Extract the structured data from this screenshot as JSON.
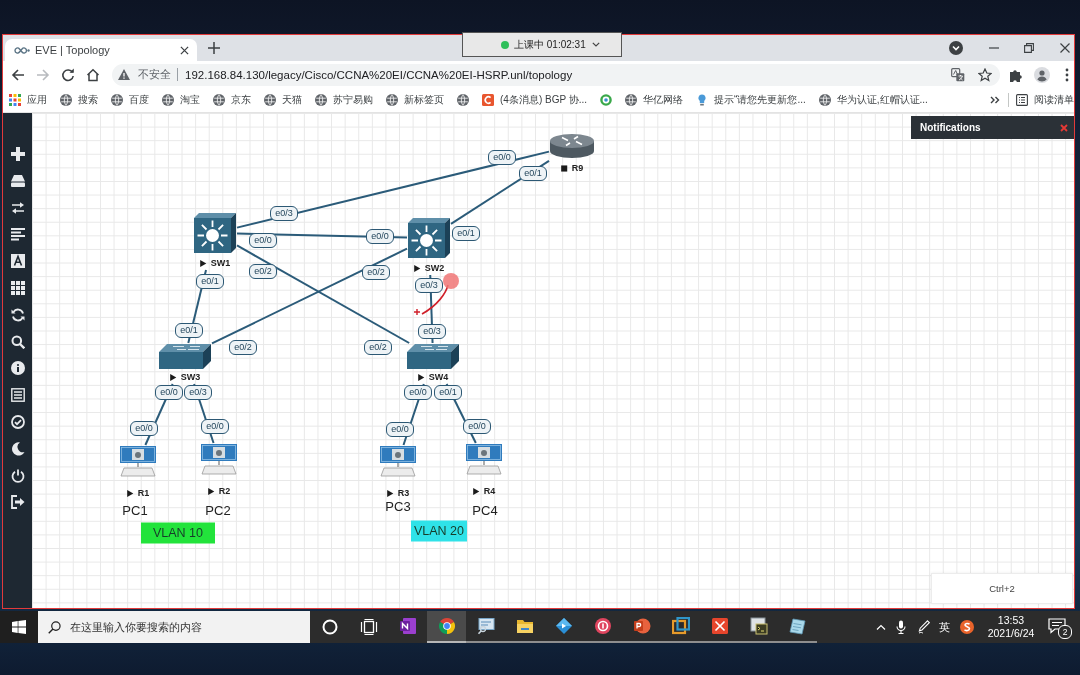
{
  "recorder": {
    "status": "上课中 01:02:31"
  },
  "browser": {
    "tabs": [
      {
        "title": "EVE | Topology",
        "selected": true
      }
    ],
    "toolbar": {
      "forward_disabled": true,
      "security_label": "不安全",
      "url": "192.168.84.130/legacy/Cisco/CCNA%20EI/CCNA%20EI-HSRP.unl/topology"
    },
    "bookmarks": [
      {
        "kind": "apps",
        "label": "应用"
      },
      {
        "kind": "globe",
        "label": "搜索"
      },
      {
        "kind": "globe",
        "label": "百度"
      },
      {
        "kind": "globe",
        "label": "淘宝"
      },
      {
        "kind": "globe",
        "label": "京东"
      },
      {
        "kind": "globe",
        "label": "天猫"
      },
      {
        "kind": "globe",
        "label": "苏宁易购"
      },
      {
        "kind": "globe",
        "label": "新标签页"
      },
      {
        "kind": "globe"
      },
      {
        "kind": "tile",
        "label": "(4条消息) BGP 协..."
      },
      {
        "kind": "ring"
      },
      {
        "kind": "globe",
        "label": "华亿网络"
      },
      {
        "kind": "bulb",
        "label": "提示“请您先更新您..."
      },
      {
        "kind": "globe",
        "label": "华为认证,红帽认证..."
      }
    ],
    "reading_list": "阅读清单"
  },
  "eve": {
    "notifications": {
      "title": "Notifications"
    },
    "nodes": [
      {
        "kind": "router",
        "name": "R9",
        "running": false
      },
      {
        "kind": "l3switch",
        "name": "SW1",
        "running": true
      },
      {
        "kind": "l3switch",
        "name": "SW2",
        "running": true
      },
      {
        "kind": "switch",
        "name": "SW3",
        "running": true
      },
      {
        "kind": "switch",
        "name": "SW4",
        "running": true
      },
      {
        "kind": "pc",
        "name": "R1",
        "running": true
      },
      {
        "kind": "pc",
        "name": "R2",
        "running": true
      },
      {
        "kind": "pc",
        "name": "R3",
        "running": true
      },
      {
        "kind": "pc",
        "name": "R4",
        "running": true
      }
    ],
    "links": [
      {
        "port_a": "e0/3",
        "port_b": "e0/0"
      },
      {
        "port_a": "e0/0",
        "port_b": "e0/0"
      },
      {
        "port_a": "e0/1",
        "port_b": "e0/1"
      },
      {
        "port_a": "e0/1",
        "port_b": "e0/1"
      },
      {
        "port_a": "e0/2",
        "port_b": "e0/2"
      },
      {
        "port_a": "e0/2",
        "port_b": "e0/2"
      },
      {
        "port_a": "e0/3",
        "port_b": "e0/3"
      },
      {
        "port_a": "e0/0",
        "port_b": "e0/0"
      },
      {
        "port_a": "e0/3",
        "port_b": "e0/0"
      },
      {
        "port_a": "e0/0",
        "port_b": "e0/0"
      },
      {
        "port_a": "e0/1",
        "port_b": "e0/0"
      }
    ],
    "text_objects": [
      {
        "kind": "plain",
        "text": "PC1"
      },
      {
        "kind": "plain",
        "text": "PC2"
      },
      {
        "kind": "plain",
        "text": "PC3"
      },
      {
        "kind": "plain",
        "text": "PC4"
      },
      {
        "kind": "box",
        "text": "VLAN 10",
        "color": "#22e33b"
      },
      {
        "kind": "box",
        "text": "VLAN 20",
        "color": "#2fe2e8"
      }
    ],
    "hint": "Ctrl+2"
  },
  "taskbar": {
    "search_placeholder": "在这里输入你要搜索的内容",
    "apps": [
      {
        "kind": "note",
        "selected": false,
        "open": false
      },
      {
        "kind": "browser",
        "selected": true,
        "open": true
      },
      {
        "kind": "monitor",
        "selected": false,
        "open": true
      },
      {
        "kind": "folder",
        "selected": false,
        "open": true
      },
      {
        "kind": "diamond",
        "selected": false,
        "open": true
      },
      {
        "kind": "badge",
        "selected": false,
        "open": true
      },
      {
        "kind": "slides",
        "selected": false,
        "open": true
      },
      {
        "kind": "squares",
        "selected": false,
        "open": true
      },
      {
        "kind": "cross",
        "selected": false,
        "open": true
      },
      {
        "kind": "terminal",
        "selected": false,
        "open": true
      },
      {
        "kind": "notepad",
        "selected": false,
        "open": true
      }
    ],
    "input_language": "英",
    "time": "13:53",
    "date": "2021/6/24",
    "notification_count": "2"
  }
}
